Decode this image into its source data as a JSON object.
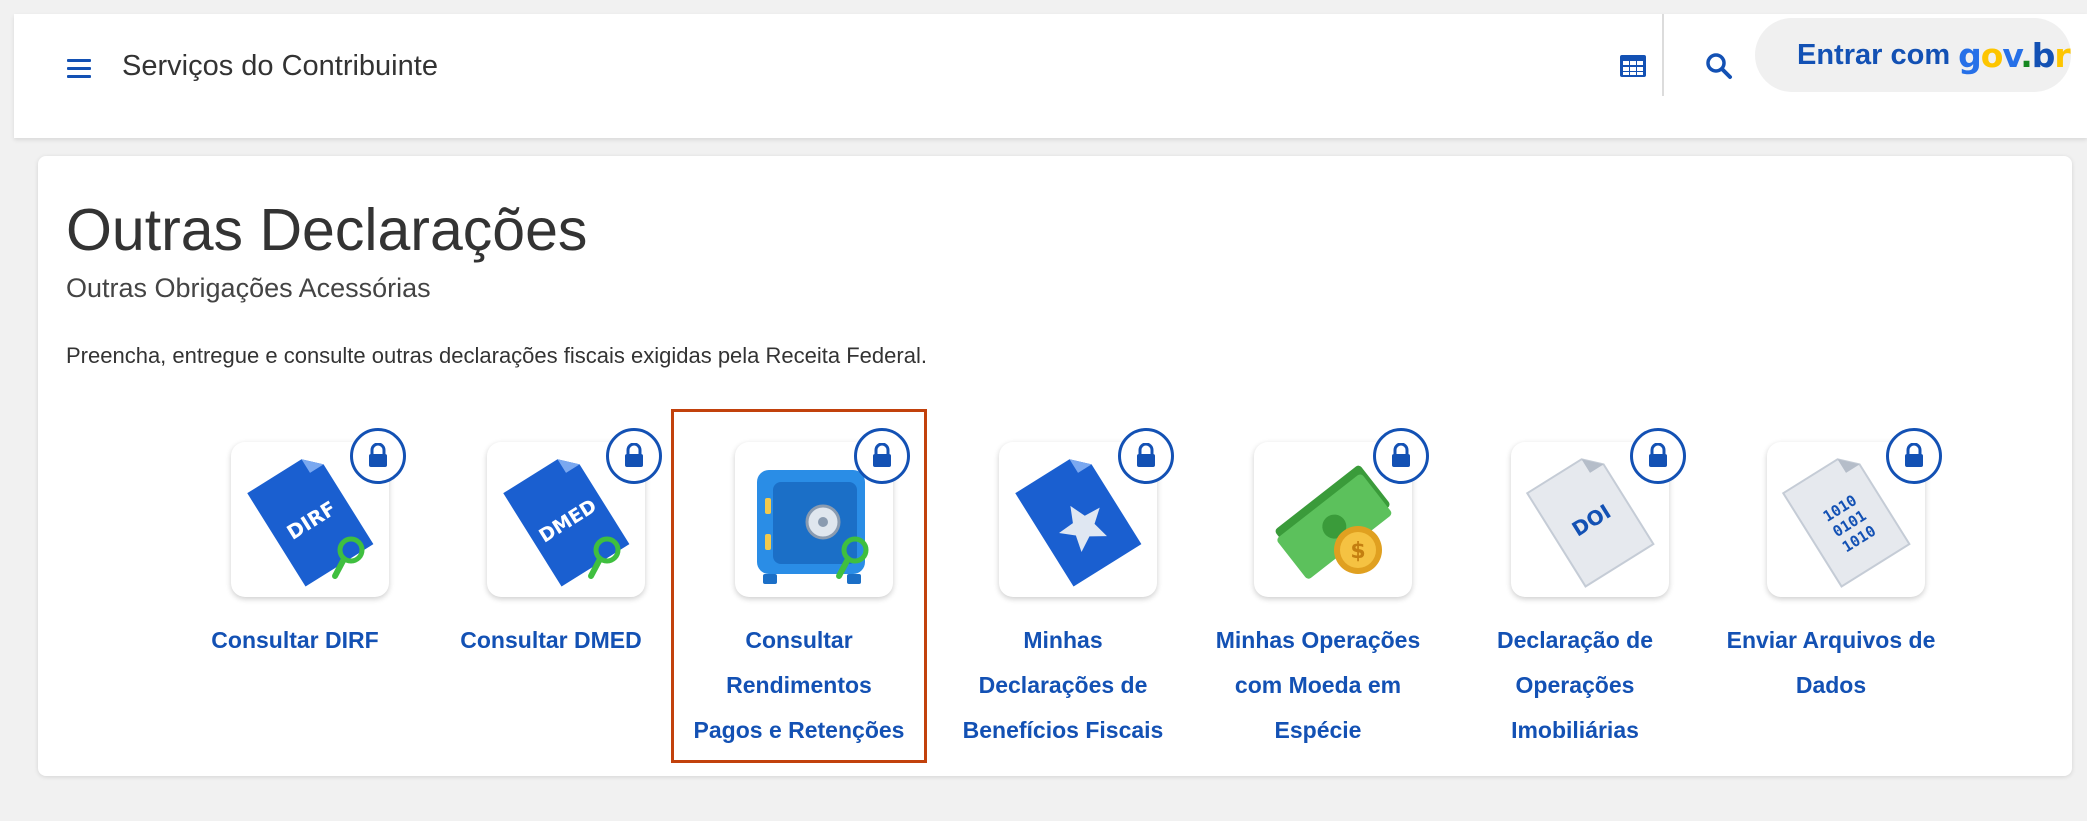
{
  "header": {
    "title": "Serviços do Contribuinte",
    "login_label": "Entrar com",
    "brand": "gov.br"
  },
  "icons": {
    "menu": "menu-icon",
    "apps": "grid-icon",
    "search": "search-icon",
    "lock": "lock-icon"
  },
  "colors": {
    "link": "#1351b4",
    "selection_outline": "#c2410c"
  },
  "page": {
    "title": "Outras Declarações",
    "subtitle": "Outras Obrigações Acessórias",
    "description": "Preencha, entregue e consulte outras declarações fiscais exigidas pela Receita Federal."
  },
  "services": [
    {
      "label": "Consultar DIRF",
      "icon": "dirf-document-icon",
      "icon_text": "DIRF"
    },
    {
      "label": "Consultar DMED",
      "icon": "dmed-document-icon",
      "icon_text": "DMED"
    },
    {
      "label": "Consultar\nRendimentos\nPagos e Retenções",
      "icon": "safe-icon",
      "selected": true
    },
    {
      "label": "Minhas\nDeclarações de\nBenefícios Fiscais",
      "icon": "star-document-icon"
    },
    {
      "label": "Minhas Operações\ncom Moeda em\nEspécie",
      "icon": "cash-coin-icon",
      "icon_text": "$"
    },
    {
      "label": "Declaração de\nOperações\nImobiliárias",
      "icon": "doi-document-icon",
      "icon_text": "DOI"
    },
    {
      "label": "Enviar Arquivos de\nDados",
      "icon": "binary-document-icon",
      "icon_text": [
        "1010",
        "0101",
        "1010"
      ]
    }
  ]
}
